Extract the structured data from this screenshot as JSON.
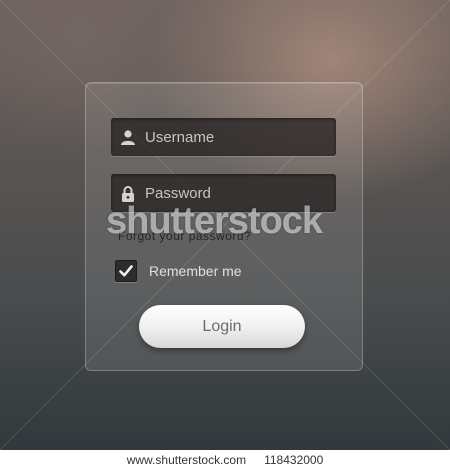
{
  "form": {
    "username_placeholder": "Username",
    "password_placeholder": "Password",
    "forgot_link": "Forgot your password?",
    "remember_label": "Remember me",
    "remember_checked": true,
    "login_label": "Login"
  },
  "icons": {
    "username": "user-icon",
    "password": "lock-icon",
    "checkbox": "checkmark-icon"
  },
  "watermark": {
    "text": "shutterstock"
  },
  "footer": {
    "site": "www.shutterstock.com",
    "image_id": "118432000"
  },
  "colors": {
    "field_bg": "#282424",
    "login_bg": "#efefef",
    "text_light": "#c9c4c2"
  }
}
